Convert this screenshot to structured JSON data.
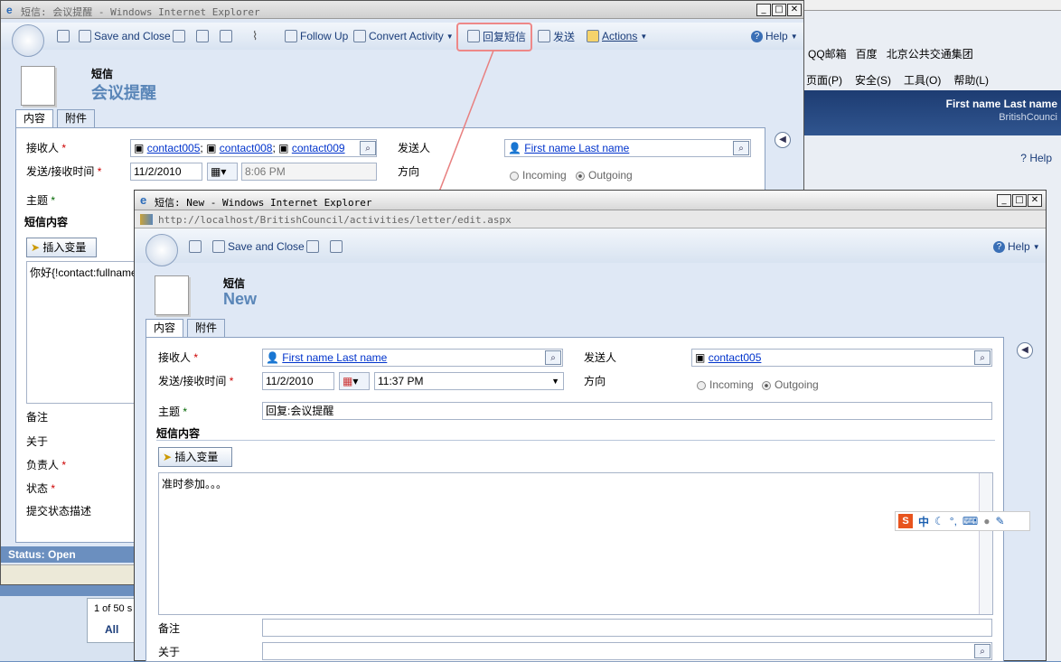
{
  "back_window": {
    "title": "短信: 会议提醒 - Windows Internet Explorer",
    "toolbar": {
      "save_close": "Save and Close",
      "follow_up": "Follow Up",
      "convert": "Convert Activity",
      "reply": "回复短信",
      "send": "发送",
      "actions": "Actions",
      "help": "Help"
    },
    "entity_type": "短信",
    "record_name": "会议提醒",
    "tabs": [
      "内容",
      "附件"
    ],
    "labels": {
      "to": "接收人",
      "datetime": "发送/接收时间",
      "subject": "主题",
      "body_heading": "短信内容",
      "from": "发送人",
      "direction": "方向",
      "notes": "备注",
      "regarding": "关于",
      "owner": "负责人",
      "status": "状态",
      "status_desc": "提交状态描述"
    },
    "to_values": [
      "contact005",
      "contact008",
      "contact009"
    ],
    "from_value": "First name Last name",
    "date": "11/2/2010",
    "time": "8:06 PM",
    "incoming": "Incoming",
    "outgoing": "Outgoing",
    "insert_var": "插入变量",
    "body_text": "你好{!contact:fullname;",
    "status_bar": "Status: Open"
  },
  "ie_background": {
    "links": [
      "QQ邮箱",
      "百度",
      "北京公共交通集团"
    ],
    "menu": [
      "页面(P)",
      "安全(S)",
      "工具(O)",
      "帮助(L)"
    ],
    "user_name": "First name Last name",
    "org": "BritishCounci",
    "help": "Help",
    "paging": "1 of 50 s",
    "all": "All"
  },
  "front_window": {
    "title": "短信: New - Windows Internet Explorer",
    "url": "http://localhost/BritishCouncil/activities/letter/edit.aspx",
    "toolbar": {
      "save_close": "Save and Close",
      "help": "Help"
    },
    "entity_type": "短信",
    "record_name": "New",
    "tabs": [
      "内容",
      "附件"
    ],
    "labels": {
      "to": "接收人",
      "datetime": "发送/接收时间",
      "subject": "主题",
      "body_heading": "短信内容",
      "from": "发送人",
      "direction": "方向",
      "notes": "备注",
      "regarding": "关于"
    },
    "to_value": "First name Last name",
    "from_value": "contact005",
    "date": "11/2/2010",
    "time": "11:37 PM",
    "incoming": "Incoming",
    "outgoing": "Outgoing",
    "subject_value": "回复:会议提醒",
    "insert_var": "插入变量",
    "body_text": "准时参加。。。"
  },
  "ime_bar": {
    "mode": "中"
  },
  "colors": {
    "highlight": "#e06060",
    "link": "#0033cc",
    "title_text": "#5a86b8"
  }
}
